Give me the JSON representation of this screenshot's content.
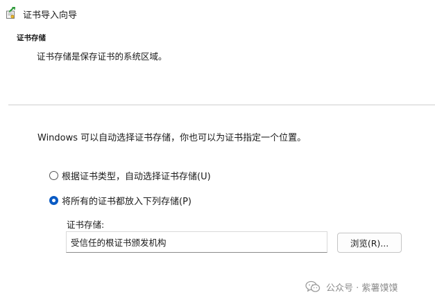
{
  "window": {
    "title": "证书导入向导",
    "icon": "certificate-import-wizard-icon"
  },
  "header": {
    "heading": "证书存储",
    "description": "证书存储是保存证书的系统区域。"
  },
  "main": {
    "intro": "Windows 可以自动选择证书存储，你也可以为证书指定一个位置。",
    "options": [
      {
        "label": "根据证书类型，自动选择证书存储(U)",
        "selected": false
      },
      {
        "label": "将所有的证书都放入下列存储(P)",
        "selected": true
      }
    ],
    "store": {
      "label": "证书存储:",
      "value": "受信任的根证书颁发机构"
    },
    "browse_label": "浏览(R)..."
  },
  "watermark": {
    "text": "公众号 · 紫薯馍馍",
    "icon": "wechat-icon"
  },
  "colors": {
    "accent": "#0a5bc4",
    "divider": "#cfcfcf",
    "watermark": "#8c8c8c"
  }
}
